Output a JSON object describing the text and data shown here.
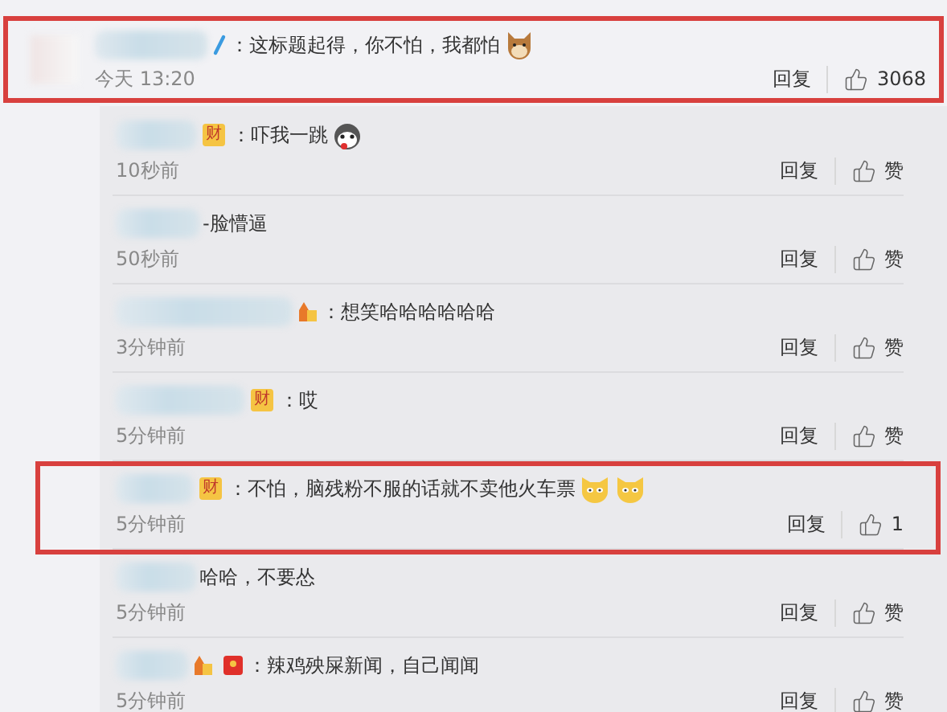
{
  "main_comment": {
    "verified": true,
    "text": "：这标题起得，你不怕，我都怕",
    "emojis": [
      {
        "kind": "dog"
      }
    ],
    "time": "今天 13:20",
    "reply_label": "回复",
    "like_label": "3068",
    "highlighted": true
  },
  "replies": [
    {
      "badges": [
        {
          "kind": "label",
          "text": "财"
        }
      ],
      "text": "：吓我一跳",
      "emojis": [
        {
          "kind": "husky"
        }
      ],
      "time": "10秒前",
      "reply_label": "回复",
      "like_label": "赞",
      "highlighted": false
    },
    {
      "text": "-脸懵逼",
      "time": "50秒前",
      "reply_label": "回复",
      "like_label": "赞",
      "highlighted": false
    },
    {
      "badges": [
        {
          "kind": "level"
        }
      ],
      "text": "：想笑哈哈哈哈哈哈",
      "time": "3分钟前",
      "reply_label": "回复",
      "like_label": "赞",
      "highlighted": false
    },
    {
      "badges": [
        {
          "kind": "label",
          "text": "财"
        }
      ],
      "text": "：哎",
      "time": "5分钟前",
      "reply_label": "回复",
      "like_label": "赞",
      "highlighted": false
    },
    {
      "badges": [
        {
          "kind": "label",
          "text": "财"
        }
      ],
      "text": "：不怕，脑残粉不服的话就不卖他火车票",
      "emojis": [
        {
          "kind": "cat"
        },
        {
          "kind": "cat"
        }
      ],
      "time": "5分钟前",
      "reply_label": "回复",
      "like_label": "1",
      "highlighted": true
    },
    {
      "text": "哈哈，不要怂",
      "time": "5分钟前",
      "reply_label": "回复",
      "like_label": "赞",
      "highlighted": false
    },
    {
      "badges": [
        {
          "kind": "level"
        },
        {
          "kind": "envelope"
        }
      ],
      "text": "：辣鸡殃屎新闻，自己闻闻",
      "time": "5分钟前",
      "reply_label": "回复",
      "like_label": "赞",
      "highlighted": false
    }
  ]
}
